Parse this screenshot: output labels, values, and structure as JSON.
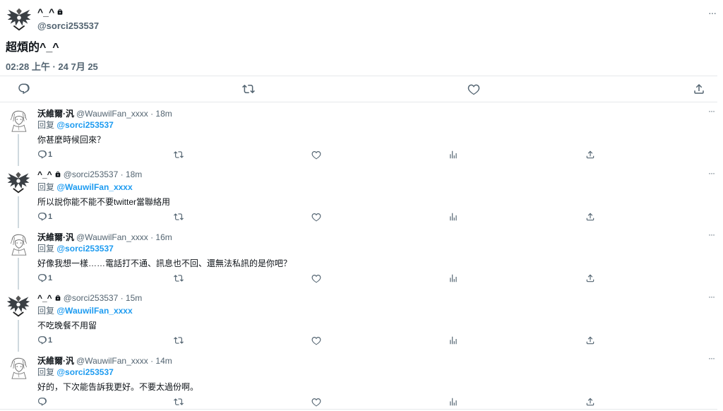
{
  "main": {
    "name": "^_^",
    "handle": "@sorci253537",
    "text": "超煩的^_^",
    "timestamp": "02:28 上午 · 24 7月 25",
    "more": "···"
  },
  "replies": [
    {
      "name": "沃維爾·汎",
      "handle_time": "@WauwilFan_xxxx · 18m",
      "replyto_label": "回复",
      "replyto": "@sorci253537",
      "text": "你甚麼時候回來？",
      "reply_count": "1",
      "more": "···",
      "avatar": "sketch",
      "locked": false
    },
    {
      "name": "^_^",
      "handle_time": "@sorci253537 · 18m",
      "replyto_label": "回复",
      "replyto": "@WauwilFan_xxxx",
      "text": "所以說你能不能不要twitter當聯絡用",
      "reply_count": "1",
      "more": "···",
      "avatar": "wings",
      "locked": true
    },
    {
      "name": "沃維爾·汎",
      "handle_time": "@WauwilFan_xxxx · 16m",
      "replyto_label": "回复",
      "replyto": "@sorci253537",
      "text": "好像我想一樣……電話打不通、訊息也不回、還無法私訊的是你吧？",
      "reply_count": "1",
      "more": "···",
      "avatar": "sketch",
      "locked": false
    },
    {
      "name": "^_^",
      "handle_time": "@sorci253537 · 15m",
      "replyto_label": "回复",
      "replyto": "@WauwilFan_xxxx",
      "text": "不吃晚餐不用留",
      "reply_count": "1",
      "more": "···",
      "avatar": "wings",
      "locked": true
    },
    {
      "name": "沃維爾·汎",
      "handle_time": "@WauwilFan_xxxx · 14m",
      "replyto_label": "回复",
      "replyto": "@sorci253537",
      "text": "好的，下次能告訴我更好。不要太過份啊。",
      "reply_count": "",
      "more": "···",
      "avatar": "sketch",
      "locked": false
    }
  ],
  "icons": {
    "reply": "reply-icon",
    "retweet": "retweet-icon",
    "like": "like-icon",
    "views": "views-icon",
    "share": "share-icon",
    "lock": "lock-icon"
  },
  "colors": {
    "text": "#0f1419",
    "secondary": "#536471",
    "mention": "#1d9bf0",
    "divider": "#e6e9eb"
  }
}
